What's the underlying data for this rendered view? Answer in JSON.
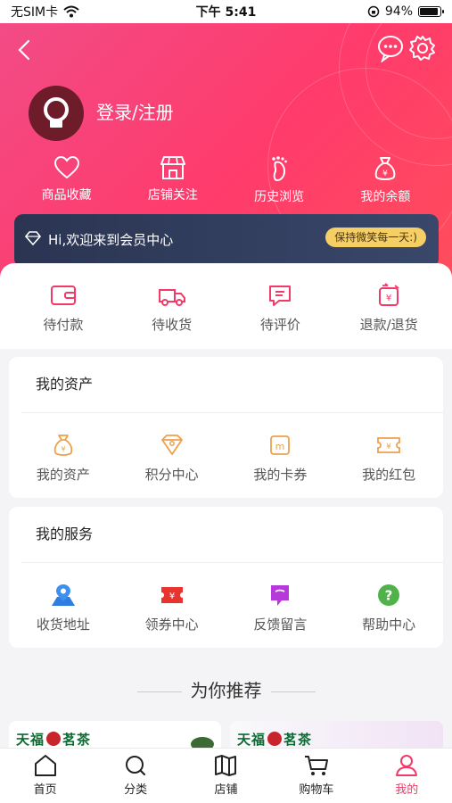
{
  "status_bar": {
    "carrier": "无SIM卡",
    "time": "下午 5:41",
    "battery": "94%",
    "battery_level": 0.94
  },
  "header": {
    "login_label": "登录/注册",
    "quick_links": [
      {
        "label": "商品收藏",
        "icon": "heart-icon"
      },
      {
        "label": "店铺关注",
        "icon": "store-icon"
      },
      {
        "label": "历史浏览",
        "icon": "footprint-icon"
      },
      {
        "label": "我的余额",
        "icon": "money-bag-icon"
      }
    ]
  },
  "member_bar": {
    "text": "Hi,欢迎来到会员中心",
    "pill": "保持微笑每一天:)"
  },
  "orders": [
    {
      "label": "待付款",
      "icon": "wallet-icon"
    },
    {
      "label": "待收货",
      "icon": "truck-icon"
    },
    {
      "label": "待评价",
      "icon": "comment-icon"
    },
    {
      "label": "退款/退货",
      "icon": "refund-icon"
    }
  ],
  "assets": {
    "title": "我的资产",
    "items": [
      {
        "label": "我的资产",
        "icon": "money-bag-icon"
      },
      {
        "label": "积分中心",
        "icon": "points-icon"
      },
      {
        "label": "我的卡券",
        "icon": "card-icon"
      },
      {
        "label": "我的红包",
        "icon": "red-packet-icon"
      }
    ]
  },
  "services": {
    "title": "我的服务",
    "items": [
      {
        "label": "收货地址",
        "icon": "map-pin-icon"
      },
      {
        "label": "领券中心",
        "icon": "coupon-icon"
      },
      {
        "label": "反馈留言",
        "icon": "feedback-icon"
      },
      {
        "label": "帮助中心",
        "icon": "help-icon"
      }
    ]
  },
  "recommend": {
    "title": "为你推荐",
    "brand": "天福",
    "brand_suffix": "茗茶"
  },
  "tabbar": [
    {
      "label": "首页",
      "icon": "home-icon",
      "active": false
    },
    {
      "label": "分类",
      "icon": "search-icon",
      "active": false
    },
    {
      "label": "店铺",
      "icon": "map-icon",
      "active": false
    },
    {
      "label": "购物车",
      "icon": "cart-icon",
      "active": false
    },
    {
      "label": "我的",
      "icon": "user-icon",
      "active": true
    }
  ],
  "colors": {
    "brand": "#ff3b6b",
    "accent_orange": "#f0a04b",
    "active_tab": "#f23a68",
    "pill": "#f5cf63"
  }
}
